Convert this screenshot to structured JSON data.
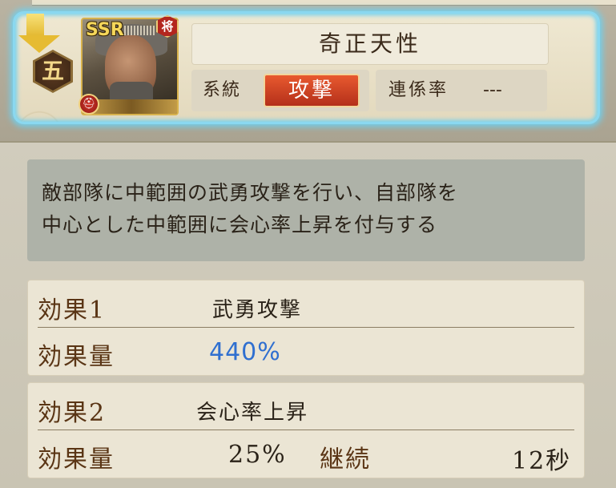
{
  "skill": {
    "rarity": "SSR",
    "rank_glyph": "五",
    "general_badge": "将",
    "name": "奇正天性",
    "type_label": "系統",
    "type_value": "攻撃",
    "chain_label": "連係率",
    "chain_value": "---"
  },
  "description": {
    "line1": "敵部隊に中範囲の武勇攻撃を行い、自部隊を",
    "line2": "中心とした中範囲に会心率上昇を付与する"
  },
  "effects": [
    {
      "title": "効果1",
      "name": "武勇攻撃",
      "amount_label": "効果量",
      "amount_value": "440%"
    },
    {
      "title": "効果2",
      "name": "会心率上昇",
      "amount_label": "効果量",
      "amount_value": "25%",
      "duration_label": "継続",
      "duration_value": "12秒"
    }
  ],
  "colors": {
    "glow": "#6fd0ef",
    "attack_badge": "#d2431f",
    "highlight_value": "#2f6fd0"
  },
  "icons": {
    "arrow": "arrow-down-icon",
    "rank": "rank-hexagon-icon",
    "general": "general-badge-icon",
    "helmet": "helmet-icon"
  }
}
